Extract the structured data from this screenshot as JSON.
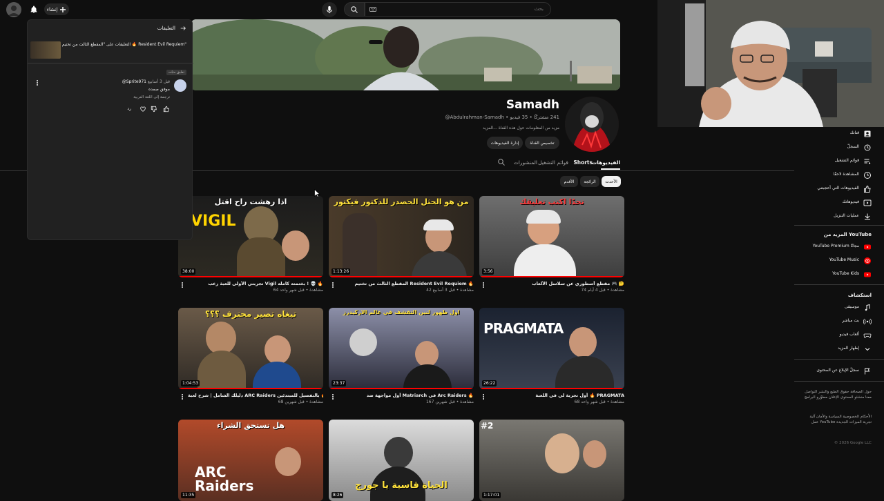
{
  "topbar": {
    "create_label": "إنشاء",
    "search_placeholder": "بحث"
  },
  "channel": {
    "name": "Samadh",
    "handle": "@Abdulrahman-Samadh",
    "meta": "@Abdulrahman-Samadh • ‏241 مشتركًا • ‏35 فيديو",
    "description": "مزيد من المعلومات حول هذه القناة ...المزيد",
    "customize_label": "تخصيص القناة",
    "manage_label": "إدارة الفيديوهات"
  },
  "tabs": [
    "الفيديوهات",
    "Shorts",
    "قوائم التشغيل",
    "المنشورات"
  ],
  "chips": [
    "الأحدث",
    "الرائجة",
    "الأقدم"
  ],
  "videos": [
    {
      "title": "مقطع أسطوري عن سلاسل الألعاب 🎮 🤔",
      "meta": "74 مشاهدة • قبل 4 أيام",
      "duration": "3:56",
      "thumb_text": "تحدّا اكتب تعليقك"
    },
    {
      "title": "المقطع الثالث من تختيم Resident Evil Requiem 🔥",
      "meta": "42 مشاهدة • قبل 3 أسابيع",
      "duration": "1:13:26",
      "thumb_text": "من هو الحثل الحصدر للدكتور فيكتور"
    },
    {
      "title": "تجربتي الأولى للعبة رعب Vigil بختمته كامله ! 💀 🔥",
      "meta": "64 مشاهدة • قبل شهر واحد",
      "duration": "38:00",
      "thumb_text": "اذا رهشت راح اقتل"
    },
    {
      "title": "أول تجربة لي في اللعبة 🔥 PRAGMATA",
      "meta": "68 مشاهدة • قبل شهر واحد",
      "duration": "26:22",
      "thumb_text": "PRAGMATA"
    },
    {
      "title": "أول مواجهة ضد Matriarch في Arc Raiders 🔥",
      "meta": "167 مشاهدة • قبل شهرين",
      "duration": "23:37",
      "thumb_text": "اول ظهور لنين التقشف في عالم الاركيدرز"
    },
    {
      "title": "دليلك الشامل | شرح لعبة ARC Raiders بالتفصيل للمبتدئين 🔥",
      "meta": "68 مشاهدة • قبل شهرين",
      "duration": "1:04:53",
      "thumb_text": "تبغاه تصير محترف ؟؟؟"
    },
    {
      "title": "",
      "meta": "",
      "duration": "1:17:01",
      "thumb_text": "#2"
    },
    {
      "title": "",
      "meta": "",
      "duration": "8:26",
      "thumb_text": "الحياة قاسية يا جورج"
    },
    {
      "title": "",
      "meta": "",
      "duration": "11:35",
      "thumb_text": "هل تستحق الشراء"
    }
  ],
  "sidebar": {
    "items": [
      {
        "label": "قناتك",
        "icon": "account-icon"
      },
      {
        "label": "السجلّ",
        "icon": "history-icon"
      },
      {
        "label": "قوائم التشغيل",
        "icon": "playlist-icon"
      },
      {
        "label": "المشاهدة لاحقًا",
        "icon": "clock-icon"
      },
      {
        "label": "الفيديوهات التي أعجبتني",
        "icon": "like-icon"
      },
      {
        "label": "فيديوهاتك",
        "icon": "video-icon"
      },
      {
        "label": "عمليات التنزيل",
        "icon": "download-icon"
      }
    ],
    "more_header": "المزيد من YouTube",
    "more_items": [
      {
        "label": "YouTube Premium مجانًا",
        "icon": "youtube-premium-icon"
      },
      {
        "label": "YouTube Music",
        "icon": "youtube-music-icon"
      },
      {
        "label": "YouTube Kids",
        "icon": "youtube-kids-icon"
      }
    ],
    "explore_header": "استكشاف",
    "explore_items": [
      {
        "label": "موسيقى",
        "icon": "music-icon"
      },
      {
        "label": "بث مباشر",
        "icon": "live-icon"
      },
      {
        "label": "ألعاب فيديو",
        "icon": "gaming-icon"
      },
      {
        "label": "إظهار المزيد",
        "icon": "chevron-down-icon"
      }
    ],
    "report_label": "سجلّ الإبلاغ عن المحتوى",
    "footer1": "حول  الصحافة  حقوق الطبع والنشر  التواصل معنا  منشئو المحتوى  الإعلان  مطوّرو البرامج",
    "footer2": "الأحكام  الخصوصية  السياسة والأمان  آلية عمل YouTube  تجربة الميزات الجديدة",
    "copyright": "© 2026 Google LLC"
  },
  "comments": {
    "title": "التعليقات",
    "video_title": "التعليقات على \"المقطع الثالث من تختيم 🔥 Resident Evil Requiem\"",
    "tag": "تعليق مثبّت",
    "author": "@Sprite971",
    "time": "قبل 3 أسابيع",
    "text": "موفق صمده",
    "translate": "ترجمة إلى اللغة العربية",
    "reply_label": "رد"
  },
  "colors": {
    "accent": "#ff0000",
    "background": "#0f0f0f",
    "chip_active": "#f1f1f1"
  }
}
